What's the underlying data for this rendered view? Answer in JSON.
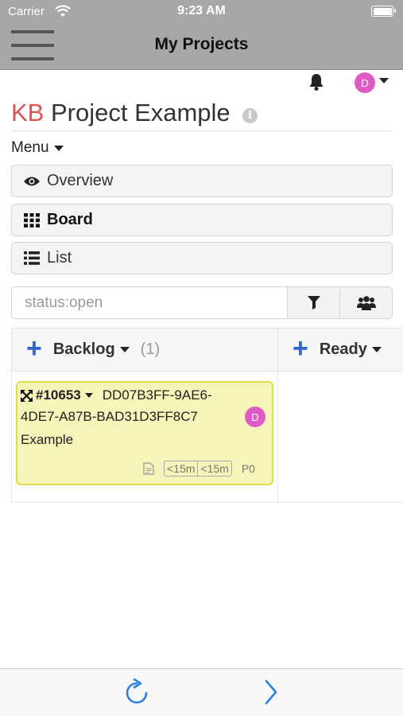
{
  "status_bar": {
    "carrier": "Carrier",
    "time": "9:23 AM"
  },
  "nav": {
    "title": "My Projects"
  },
  "header": {
    "user_initial": "D"
  },
  "project": {
    "prefix": "KB",
    "name": " Project Example"
  },
  "menu": {
    "toggle_label": "Menu",
    "items": [
      {
        "label": "Overview",
        "icon": "eye-icon"
      },
      {
        "label": "Board",
        "icon": "grid-icon",
        "active": true
      },
      {
        "label": "List",
        "icon": "list-icon"
      }
    ]
  },
  "search": {
    "placeholder": "status:open"
  },
  "board": {
    "columns": [
      {
        "name": "Backlog",
        "count": "(1)"
      },
      {
        "name": "Ready"
      }
    ],
    "task": {
      "id": "#10653",
      "ref_line1": "DD07B3FF-9AE6-",
      "ref_line2": "4DE7-A87B-BAD31D3FF8C7",
      "assignee_initial": "D",
      "title": "Example",
      "time_estimated": "<15m",
      "time_spent": "<15m",
      "priority": "P0",
      "color": "#f5f5b9"
    }
  },
  "colors": {
    "accent": "#2f66c8",
    "avatar": "#e05ac6",
    "kb_brand": "#d9534f",
    "task_border": "#dede4c"
  }
}
